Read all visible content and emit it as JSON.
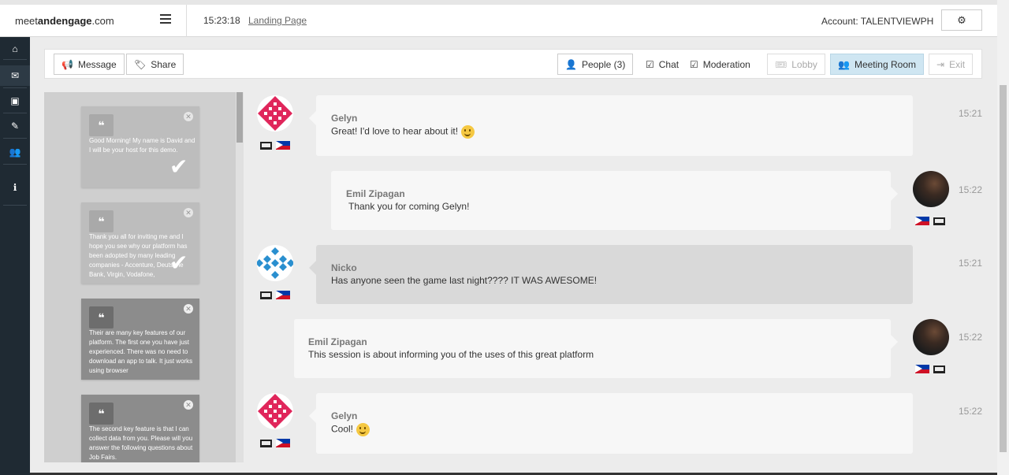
{
  "header": {
    "brand_prefix": "meet",
    "brand_bold": "andengage",
    "brand_suffix": ".com",
    "clock": "15:23:18",
    "landing_link": "Landing Page",
    "account": "Account: TALENTVIEWPH"
  },
  "sidebar": {
    "items": [
      {
        "icon": "home-icon",
        "glyph": "⌂"
      },
      {
        "icon": "chat-icon",
        "glyph": "✉"
      },
      {
        "icon": "image-icon",
        "glyph": "▣"
      },
      {
        "icon": "edit-icon",
        "glyph": "✎"
      },
      {
        "icon": "users-icon",
        "glyph": "👥"
      },
      {
        "icon": "info-icon",
        "glyph": "ℹ"
      }
    ]
  },
  "toolbar": {
    "message": "Message",
    "share": "Share",
    "people": "People (3)",
    "chat": "Chat",
    "moderation": "Moderation",
    "lobby": "Lobby",
    "meeting_room": "Meeting Room",
    "exit": "Exit"
  },
  "notes": [
    {
      "text": "Good Morning! My name is David and I will be your host for this demo.",
      "checked": true
    },
    {
      "text": "Thank you all for inviting me and I hope you see why our platform has been adopted by many leading companies - Accenture, Deutsche Bank, Virgin, Vodafone,",
      "checked": true
    },
    {
      "text": "Their are many key features of our platform. The first one you have just experienced. There was no need to download an app to talk. It just works using browser",
      "checked": false
    },
    {
      "text": "The second key feature is that I can collect data from you. Please will you answer the following questions about Job Fairs.",
      "checked": false
    }
  ],
  "messages": [
    {
      "name": "Gelyn",
      "body": "Great! I'd love to hear about it!",
      "time": "15:21",
      "side": "left"
    },
    {
      "name": "Emil Zipagan",
      "body": "Thank you for coming Gelyn!",
      "time": "15:22",
      "side": "right"
    },
    {
      "name": "Nicko",
      "body": "Has anyone seen the game last night???? IT WAS AWESOME!",
      "time": "15:21",
      "side": "left"
    },
    {
      "name": "Emil Zipagan",
      "body": "This session is about informing you of the uses of this great platform",
      "time": "15:22",
      "side": "right"
    },
    {
      "name": "Gelyn",
      "body": "Cool!",
      "time": "15:22",
      "side": "left"
    }
  ]
}
